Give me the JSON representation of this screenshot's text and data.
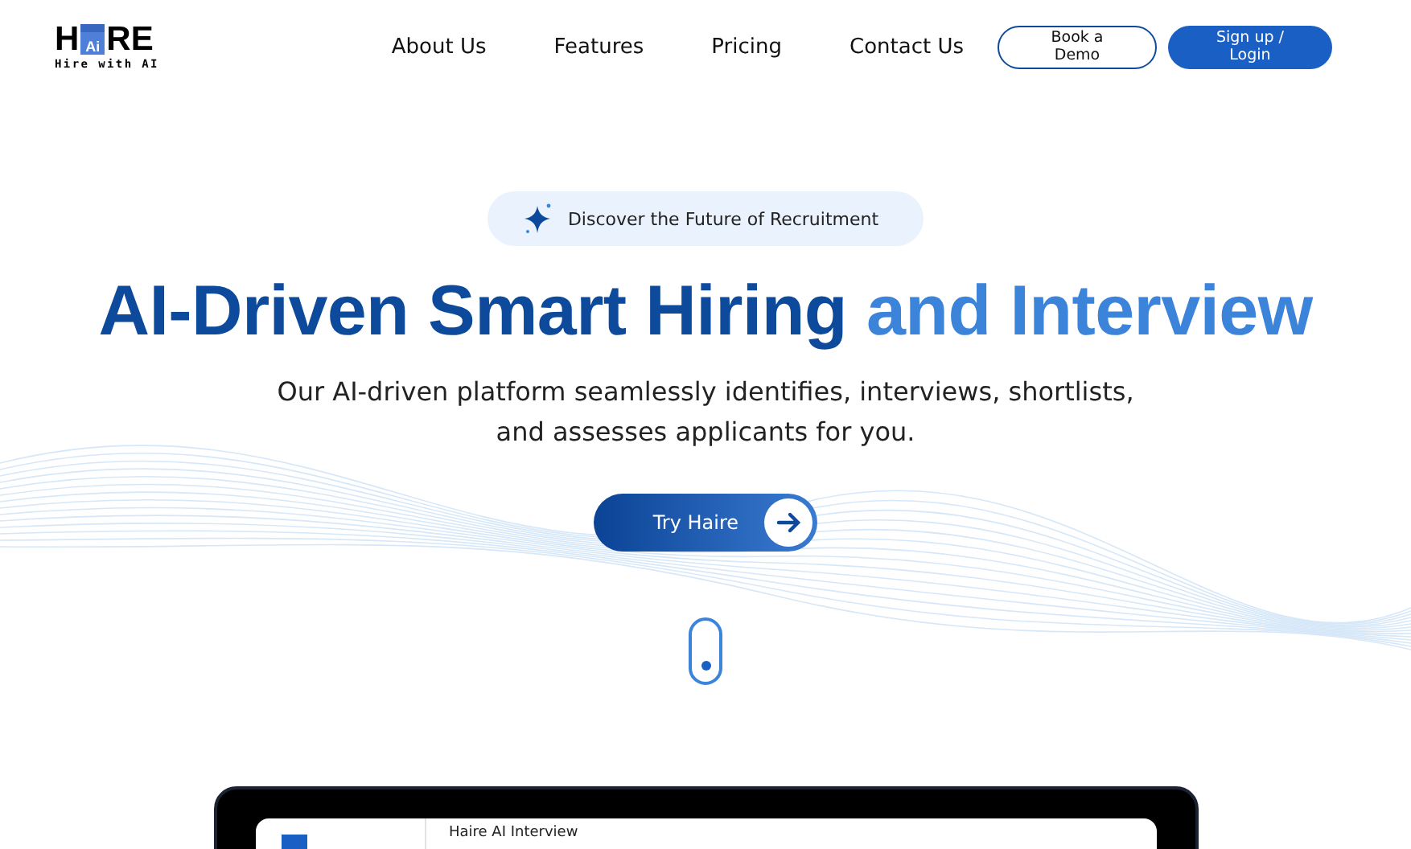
{
  "logo": {
    "left": "H",
    "badge": "Ai",
    "right": "RE",
    "tagline": "Hire with AI"
  },
  "nav": {
    "links": [
      "About Us",
      "Features",
      "Pricing",
      "Contact Us"
    ],
    "buttons": [
      {
        "label": "Book a Demo",
        "kind": "outline"
      },
      {
        "label": "Sign up / Login",
        "kind": "filled"
      }
    ]
  },
  "hero": {
    "badge": "Discover the Future of Recruitment",
    "title_main": "AI-Driven Smart Hiring",
    "title_accent": "and Interview",
    "subtitle": "Our AI-driven platform seamlessly identifies, interviews, shortlists, and assesses applicants for you.",
    "cta": "Try Haire"
  },
  "preview": {
    "heading": "Haire AI Interview"
  }
}
